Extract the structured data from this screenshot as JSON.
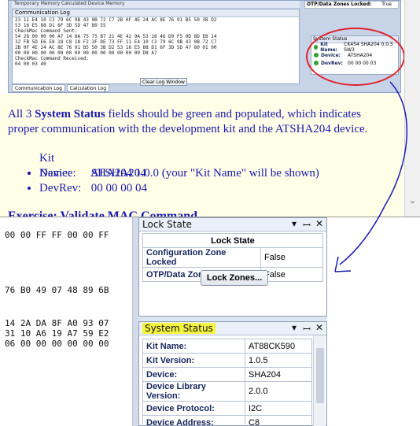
{
  "hex_pane": {
    "lines": [
      "00 00 FF FF 00 00 FF",
      "76 B0 49 07 48 89 6B",
      "14 2A DA 8F A0 93 07",
      "31 10 A6 19 A7 59 E2",
      "06 00 00 00 00 00 00"
    ]
  },
  "lock_state": {
    "title": "Lock State",
    "header": "Lock State",
    "rows": [
      {
        "key": "Configuration Zone Locked",
        "value": "False"
      },
      {
        "key": "OTP/Data Zones Locked",
        "value": "False"
      }
    ],
    "button_label": "Lock Zones..."
  },
  "system_status": {
    "title": "System Status",
    "rows": [
      {
        "key": "Kit Name:",
        "value": "AT88CK590"
      },
      {
        "key": "Kit Version:",
        "value": "1.0.5"
      },
      {
        "key": "Device:",
        "value": "SHA204"
      },
      {
        "key": "Device Library Version:",
        "value": "2.0.0"
      },
      {
        "key": "Device Protocol:",
        "value": "I2C"
      },
      {
        "key": "Device Address:",
        "value": "C8"
      }
    ]
  },
  "panel_controls": {
    "dropdown": "▾",
    "pin": "ꟷ",
    "close": "✕"
  },
  "doc": {
    "embedded": {
      "top_strip": "Temporary Memory     Calculated                          Device Memory",
      "log_title": "Communication Log",
      "log_lines": [
        "23 11 E4 10 C3 79 6C 9B 43 0B 72 C7 2B 0F 4E 24 AC 8E 76 91 B5 50 3B D2",
        "53 16 E5 88 D1 6F 3D 5D 47 80 55",
        "CheckMac Command Sent:",
        "54 28 00 00 00 A7 14 8A 75 75 B7 21 4E 42 9A 53 18 46 D9 F5 0D 8D EB 14",
        "32 FB 5D E6 E8 18 C8 18 F2 3F DE 73 FF 11 E4 10 C3 79 6C 9B 43 0B 72 C7",
        "2B 0F 4E 24 AC 8E 76 91 B5 50 3B D2 53 16 E5 88 D1 6F 3D 5D 47 80 01 00",
        "00 00 00 00 00 00 00 00 00 00 00 00 00 00 00 D8 A7",
        "CheckMac Command Received:",
        "04 00 03 40"
      ],
      "clear_button": "Clear Log Window",
      "tabs": [
        "Communication Log",
        "Calculation Log"
      ],
      "otp_label": "OTP/Data Zones Locked:",
      "otp_value": "True",
      "sys_title": "System Status",
      "sys_rows": [
        {
          "key": "Kit Name:",
          "value": "CK454 SHA204 0.0.5 SW3"
        },
        {
          "key": "Device:",
          "value": "ATSHA204"
        },
        {
          "key": "DevRev:",
          "value": "00 00 00 03"
        }
      ]
    },
    "note": {
      "line1_pre": "All 3 ",
      "line1_bold": "System Status",
      "line1_post": " fields should be green and populated, which indicates proper communication with the development kit and the ATSHA204 device.",
      "items": [
        {
          "label": "Kit Name:",
          "value": "SHA204 1.0.0 (your \"Kit Name\" will be shown)"
        },
        {
          "label": "Device:",
          "value": "ATSHA204"
        },
        {
          "label": "DevRev:",
          "value": "00 00 00 04"
        }
      ],
      "cut_heading": "Exercise: Validate MAC Command"
    }
  },
  "colors": {
    "annotation_red": "#e0202a",
    "annotation_blue": "#1a1ab0",
    "highlight_yellow": "#f5f542",
    "status_green": "#2ea42e"
  }
}
